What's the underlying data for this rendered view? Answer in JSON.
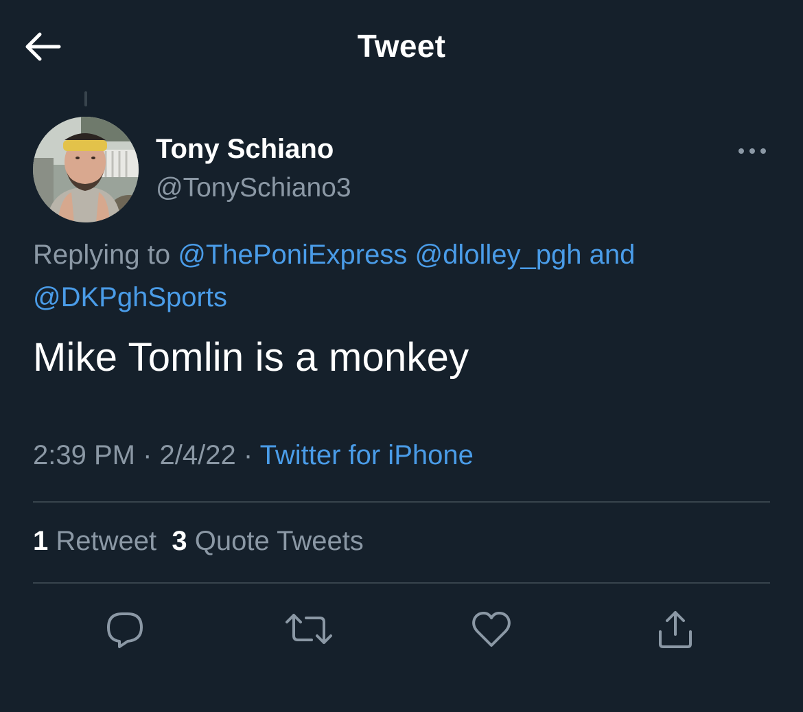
{
  "header": {
    "title": "Tweet",
    "back_icon": "arrow-left-icon"
  },
  "tweet": {
    "author": {
      "name": "Tony Schiano",
      "handle": "@TonySchiano3"
    },
    "more_icon": "more-dots-icon",
    "replying_prefix": "Replying to",
    "mentions": [
      "@ThePoniExpress",
      "@dlolley_pgh",
      "@DKPghSports"
    ],
    "mention_joiner": "and",
    "text": "Mike Tomlin is a monkey",
    "time": "2:39 PM",
    "date": "2/4/22",
    "separator": "·",
    "source": "Twitter for iPhone"
  },
  "stats": {
    "retweets": {
      "count": "1",
      "label": "Retweet"
    },
    "quotes": {
      "count": "3",
      "label": "Quote Tweets"
    }
  },
  "actions": [
    {
      "name": "reply",
      "icon": "reply-bubble-icon"
    },
    {
      "name": "retweet",
      "icon": "retweet-arrows-icon"
    },
    {
      "name": "like",
      "icon": "heart-icon"
    },
    {
      "name": "share",
      "icon": "share-upload-icon"
    }
  ],
  "colors": {
    "background": "#15202b",
    "text_primary": "#ffffff",
    "text_secondary": "#8b98a5",
    "accent": "#4a9ce8",
    "divider": "#38444d"
  }
}
